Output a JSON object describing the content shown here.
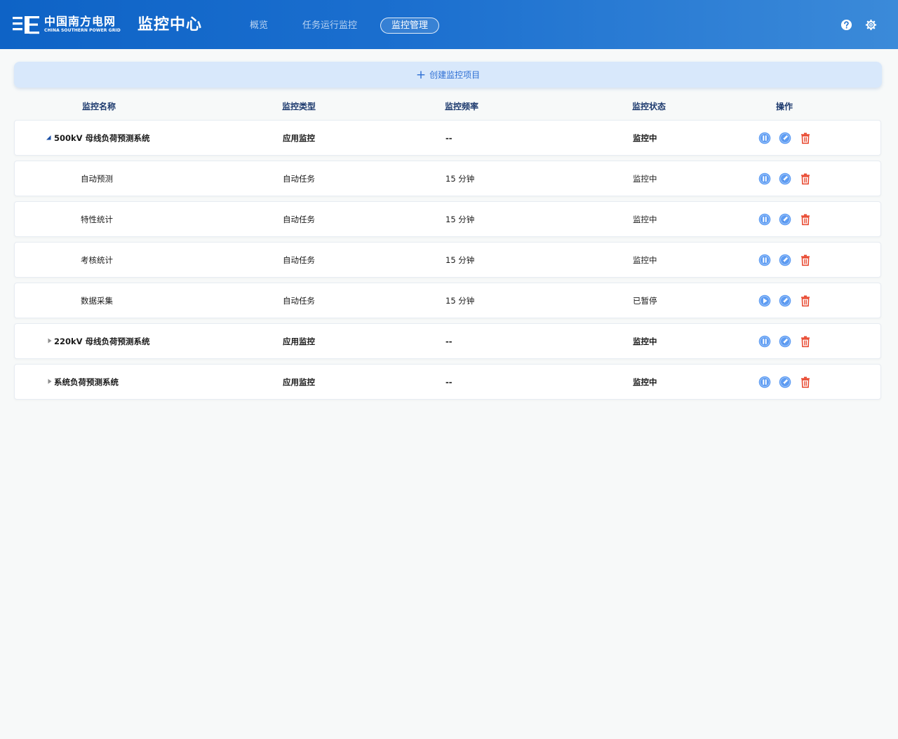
{
  "header": {
    "brand_cn": "中国南方电网",
    "brand_en": "CHINA SOUTHERN POWER GRID",
    "app_title": "监控中心",
    "tabs": [
      {
        "label": "概览",
        "active": false
      },
      {
        "label": "任务运行监控",
        "active": false
      },
      {
        "label": "监控管理",
        "active": true
      }
    ],
    "icons": [
      "help-icon",
      "gear-icon"
    ]
  },
  "create_button": {
    "label": "创建监控项目",
    "icon": "plus-icon"
  },
  "table": {
    "columns": [
      "监控名称",
      "监控类型",
      "监控频率",
      "监控状态",
      "操作"
    ],
    "rows": [
      {
        "name": "500kV 母线负荷预测系统",
        "type": "应用监控",
        "freq": "--",
        "status": "监控中",
        "level": "parent",
        "expanded": true,
        "toggle": "pause"
      },
      {
        "name": "自动预测",
        "type": "自动任务",
        "freq": "15 分钟",
        "status": "监控中",
        "level": "child",
        "toggle": "pause"
      },
      {
        "name": "特性统计",
        "type": "自动任务",
        "freq": "15 分钟",
        "status": "监控中",
        "level": "child",
        "toggle": "pause"
      },
      {
        "name": "考核统计",
        "type": "自动任务",
        "freq": "15 分钟",
        "status": "监控中",
        "level": "child",
        "toggle": "pause"
      },
      {
        "name": "数据采集",
        "type": "自动任务",
        "freq": "15 分钟",
        "status": "已暂停",
        "level": "child",
        "toggle": "play"
      },
      {
        "name": "220kV 母线负荷预测系统",
        "type": "应用监控",
        "freq": "--",
        "status": "监控中",
        "level": "parent",
        "expanded": false,
        "toggle": "pause"
      },
      {
        "name": "系统负荷预测系统",
        "type": "应用监控",
        "freq": "--",
        "status": "监控中",
        "level": "parent",
        "expanded": false,
        "toggle": "pause"
      }
    ]
  },
  "colors": {
    "header_start": "#0e63c6",
    "header_end": "#3b8ad9",
    "action_blue": "#5d9cf3",
    "delete_red": "#e8452c",
    "create_bg": "#d8e8fb"
  }
}
